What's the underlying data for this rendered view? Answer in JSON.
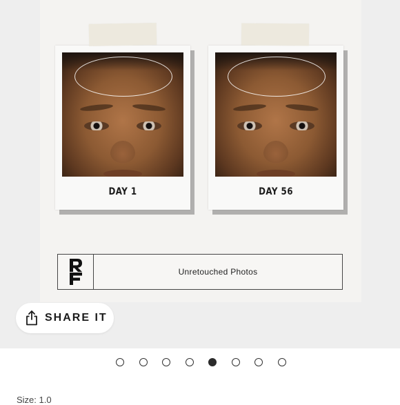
{
  "gallery": {
    "before_caption": "DAY 1",
    "after_caption": "DAY 56",
    "badge_text": "Unretouched Photos",
    "logo_text": "RF"
  },
  "share": {
    "label": "SHARE IT",
    "icon": "share-icon"
  },
  "pagination": {
    "total": 8,
    "active_index": 4
  },
  "size_row": {
    "label": "Size: 1.0"
  },
  "colors": {
    "panel_background": "#f4f3f1",
    "active_dot": "#2b2b2b"
  }
}
